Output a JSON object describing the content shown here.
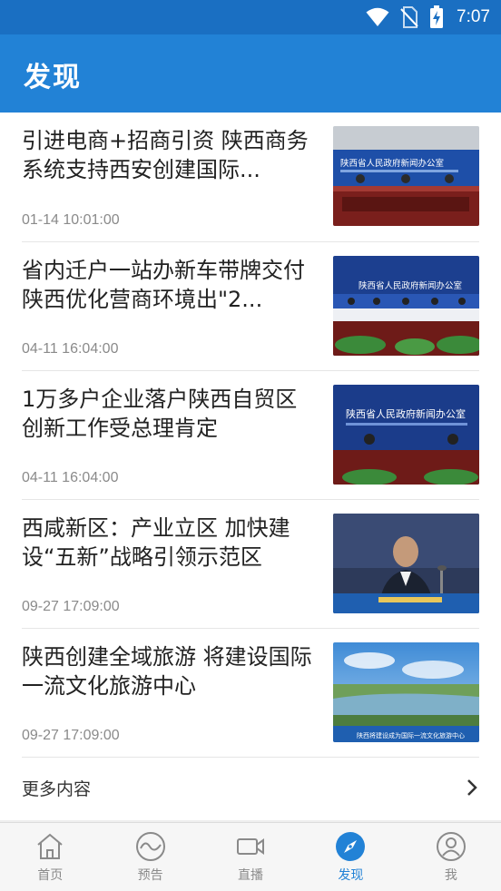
{
  "status_bar": {
    "time": "7:07",
    "icons": [
      "wifi-icon",
      "no-sim-icon",
      "battery-charging-icon"
    ]
  },
  "app_bar": {
    "title": "发现"
  },
  "news": [
    {
      "title": "引进电商+招商引资 陕西商务系统支持西安创建国际...",
      "time": "01-14 10:01:00",
      "thumb_caption": "陕西省人民政府新闻办公室"
    },
    {
      "title": "省内迁户一站办新车带牌交付 陕西优化营商环境出\"2...",
      "time": "04-11 16:04:00",
      "thumb_caption": "陕西省人民政府新闻办公室"
    },
    {
      "title": "1万多户企业落户陕西自贸区 创新工作受总理肯定",
      "time": "04-11 16:04:00",
      "thumb_caption": "陕西省人民政府新闻办公室"
    },
    {
      "title": "西咸新区：产业立区 加快建设“五新”战略引领示范区",
      "time": "09-27 17:09:00",
      "thumb_caption": ""
    },
    {
      "title": "陕西创建全域旅游 将建设国际一流文化旅游中心",
      "time": "09-27 17:09:00",
      "thumb_caption": "陕西将建设成为国际一流文化旅游中心"
    }
  ],
  "more": {
    "label": "更多内容",
    "icon": "chevron-right-icon"
  },
  "bottom_nav": [
    {
      "label": "首页",
      "icon": "home-icon",
      "active": false
    },
    {
      "label": "预告",
      "icon": "wave-icon",
      "active": false
    },
    {
      "label": "直播",
      "icon": "video-camera-icon",
      "active": false
    },
    {
      "label": "发现",
      "icon": "compass-icon",
      "active": true
    },
    {
      "label": "我",
      "icon": "user-icon",
      "active": false
    }
  ],
  "colors": {
    "accent": "#2282d6",
    "status_bar": "#1a6fc2",
    "text": "#222222",
    "muted": "#8a8a8a"
  }
}
